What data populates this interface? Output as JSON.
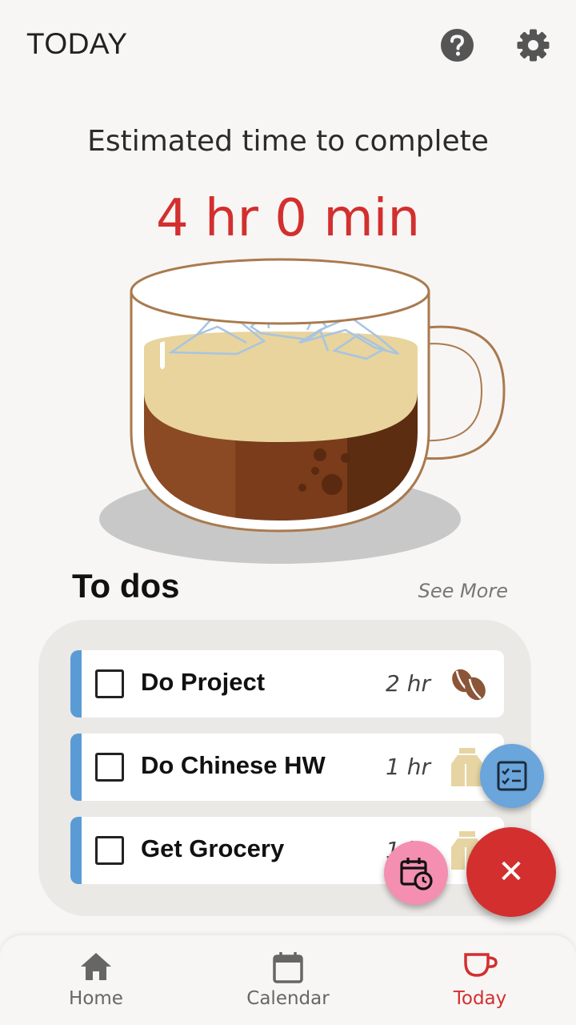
{
  "header": {
    "title": "TODAY",
    "help_icon": "help-circle-icon",
    "settings_icon": "gear-icon"
  },
  "estimate": {
    "label": "Estimated time to complete",
    "value": "4 hr 0 min"
  },
  "todos": {
    "title": "To dos",
    "see_more": "See More",
    "items": [
      {
        "name": "Do Project",
        "duration": "2 hr",
        "icon": "coffee-beans-icon"
      },
      {
        "name": "Do Chinese HW",
        "duration": "1 hr",
        "icon": "milk-carton-icon"
      },
      {
        "name": "Get Grocery",
        "duration": "1 hr",
        "icon": "milk-carton-icon"
      }
    ]
  },
  "fabs": {
    "checklist_icon": "checklist-icon",
    "schedule_icon": "calendar-clock-icon",
    "close_icon": "close-icon",
    "close_glyph": "✕"
  },
  "nav": {
    "items": [
      {
        "label": "Home",
        "icon": "home-icon"
      },
      {
        "label": "Calendar",
        "icon": "calendar-icon"
      },
      {
        "label": "Today",
        "icon": "cup-icon"
      }
    ],
    "active": "Today"
  },
  "colors": {
    "accent": "#d32f2f",
    "stripe": "#5b9bd5",
    "checklist_fab": "#6aa5dc",
    "schedule_fab": "#f48fb1",
    "background": "#f7f6f4"
  }
}
